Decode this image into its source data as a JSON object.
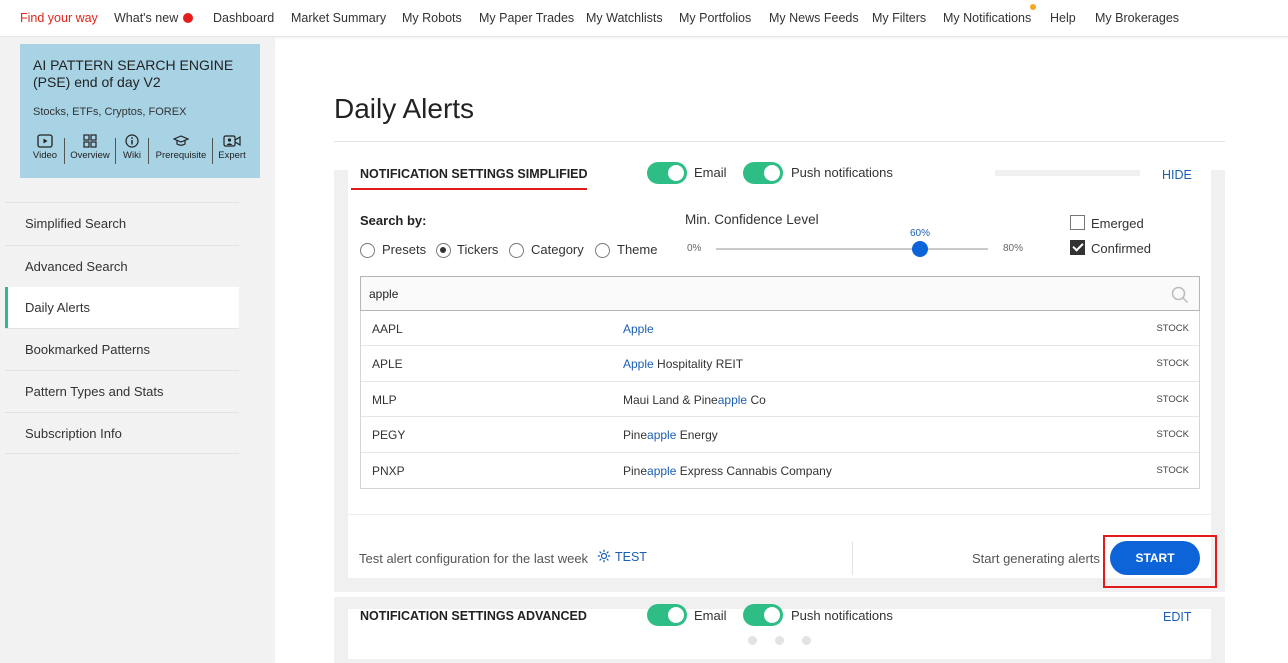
{
  "nav": {
    "items": [
      {
        "label": "Find your way"
      },
      {
        "label": "What's new"
      },
      {
        "label": "Dashboard"
      },
      {
        "label": "Market Summary"
      },
      {
        "label": "My Robots"
      },
      {
        "label": "My Paper Trades"
      },
      {
        "label": "My Watchlists"
      },
      {
        "label": "My Portfolios"
      },
      {
        "label": "My News Feeds"
      },
      {
        "label": "My Filters"
      },
      {
        "label": "My Notifications"
      },
      {
        "label": "Help"
      },
      {
        "label": "My Brokerages"
      }
    ],
    "accent": "#e2261c"
  },
  "engine_card": {
    "title": "AI PATTERN SEARCH ENGINE (PSE) end of day V2",
    "subtitle": "Stocks, ETFs, Cryptos, FOREX",
    "tools": [
      {
        "label": "Video",
        "icon": "play-icon"
      },
      {
        "label": "Overview",
        "icon": "grid-icon"
      },
      {
        "label": "Wiki",
        "icon": "info-icon"
      },
      {
        "label": "Prerequisite",
        "icon": "graduation-cap-icon"
      },
      {
        "label": "Expert",
        "icon": "video-person-icon"
      }
    ],
    "bg_color": "#a8d3e5"
  },
  "sidebar": {
    "items": [
      {
        "label": "Simplified Search"
      },
      {
        "label": "Advanced Search"
      },
      {
        "label": "Daily Alerts",
        "active": true
      },
      {
        "label": "Bookmarked Patterns"
      },
      {
        "label": "Pattern Types and Stats"
      },
      {
        "label": "Subscription Info"
      }
    ]
  },
  "page": {
    "title": "Daily Alerts"
  },
  "simplified": {
    "title": "NOTIFICATION SETTINGS SIMPLIFIED",
    "email_label": "Email",
    "push_label": "Push notifications",
    "email_on": true,
    "push_on": true,
    "hide_label": "HIDE",
    "search_by_label": "Search by:",
    "search_by_options": [
      {
        "label": "Presets",
        "selected": false
      },
      {
        "label": "Tickers",
        "selected": true
      },
      {
        "label": "Category",
        "selected": false
      },
      {
        "label": "Theme",
        "selected": false
      }
    ],
    "confidence": {
      "label": "Min. Confidence Level",
      "min_label": "0%",
      "max_label": "80%",
      "value_label": "60%",
      "value": 60,
      "min": 0,
      "max": 80
    },
    "checkboxes": [
      {
        "label": "Emerged",
        "checked": false
      },
      {
        "label": "Confirmed",
        "checked": true
      }
    ],
    "search": {
      "value": "apple",
      "icon": "search-icon"
    },
    "results": [
      {
        "symbol": "AAPL",
        "name_pre": "",
        "name_hl": "Apple",
        "name_post": "",
        "type": "STOCK"
      },
      {
        "symbol": "APLE",
        "name_pre": "",
        "name_hl": "Apple",
        "name_post": " Hospitality REIT",
        "type": "STOCK"
      },
      {
        "symbol": "MLP",
        "name_pre": "Maui Land & Pine",
        "name_hl": "apple",
        "name_post": " Co",
        "type": "STOCK"
      },
      {
        "symbol": "PEGY",
        "name_pre": "Pine",
        "name_hl": "apple",
        "name_post": " Energy",
        "type": "STOCK"
      },
      {
        "symbol": "PNXP",
        "name_pre": "Pine",
        "name_hl": "apple",
        "name_post": " Express Cannabis Company",
        "type": "STOCK"
      }
    ],
    "test_text": "Test alert configuration for the last week",
    "test_label": "TEST",
    "start_text": "Start generating alerts",
    "start_label": "START"
  },
  "advanced": {
    "title": "NOTIFICATION SETTINGS ADVANCED",
    "email_label": "Email",
    "push_label": "Push notifications",
    "email_on": true,
    "push_on": true,
    "edit_label": "EDIT"
  },
  "colors": {
    "toggle": "#2ebd85",
    "link": "#1a5fb4",
    "start_button": "#0d63d8",
    "highlight_box": "#e01b1b"
  }
}
